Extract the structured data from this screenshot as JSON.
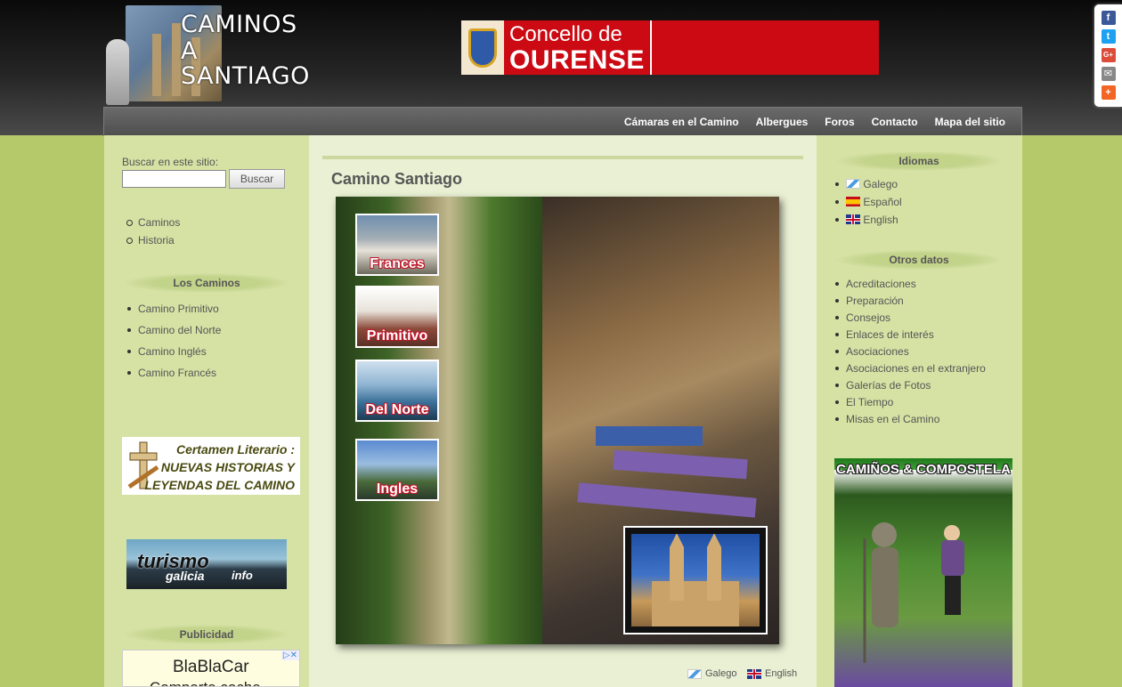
{
  "header": {
    "logo_words": [
      "CAMINOS",
      "A",
      "SANTIAGO"
    ],
    "banner_line1": "Concello de",
    "banner_line2": "OURENSE"
  },
  "social": [
    {
      "name": "facebook",
      "glyph": "f",
      "color": "#3b5998"
    },
    {
      "name": "twitter",
      "glyph": "t",
      "color": "#1da1f2"
    },
    {
      "name": "google-plus",
      "glyph": "G+",
      "color": "#dd4b39"
    },
    {
      "name": "email",
      "glyph": "✉",
      "color": "#888888"
    },
    {
      "name": "share",
      "glyph": "+",
      "color": "#f26522"
    }
  ],
  "nav": [
    "Cámaras en el Camino",
    "Albergues",
    "Foros",
    "Contacto",
    "Mapa del sitio"
  ],
  "left": {
    "search_label": "Buscar en este sitio:",
    "search_button": "Buscar",
    "top_links": [
      "Caminos",
      "Historia"
    ],
    "caminos_heading": "Los Caminos",
    "caminos": [
      "Camino Primitivo",
      "Camino del Norte",
      "Camino Inglés",
      "Camino Francés"
    ],
    "certamen_lines": [
      "Certamen Literario :",
      "NUEVAS HISTORIAS Y",
      "LEYENDAS DEL CAMINO"
    ],
    "turismo_word1": "turismo",
    "turismo_word2": "galicia",
    "turismo_word3": "info",
    "ads_heading": "Publicidad",
    "ad_line1": "BlaBlaCar",
    "ad_line2": "Comparte coche"
  },
  "center": {
    "title": "Camino Santiago",
    "thumbs": [
      "Frances",
      "Primitivo",
      "Del Norte",
      "Ingles"
    ],
    "lang_links": [
      "Galego",
      "English"
    ]
  },
  "right": {
    "idiomas_heading": "Idiomas",
    "languages": [
      "Galego",
      "Español",
      "English"
    ],
    "otros_heading": "Otros datos",
    "otros": [
      "Acreditaciones",
      "Preparación",
      "Consejos",
      "Enlaces de interés",
      "Asociaciones",
      "Asociaciones en el extranjero",
      "Galerías de Fotos",
      "El Tiempo",
      "Misas en el Camino"
    ],
    "poster_title": "CAMIÑOS & COMPOSTELA"
  }
}
